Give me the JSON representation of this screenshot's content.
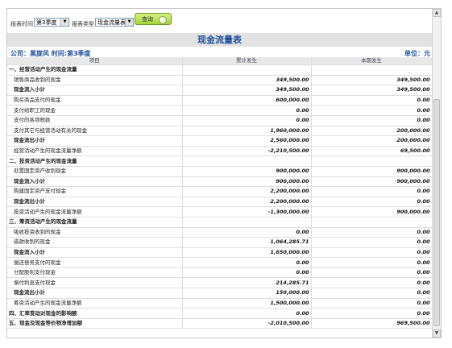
{
  "toolbar": {
    "period_label": "报表时间",
    "period_value": "第3季度",
    "type_label": "报表类型",
    "type_value": "现金流量表",
    "query_button": "查询"
  },
  "report": {
    "title": "现金流量表",
    "company_line": "公司：黑旋风  时间:第3季度",
    "unit_line": "单位：元",
    "columns": [
      "项目",
      "累计发生",
      "本期发生"
    ],
    "rows": [
      {
        "kind": "section",
        "label": "一、经营活动产生的现金流量",
        "cum": "",
        "cur": ""
      },
      {
        "kind": "sub",
        "label": "销售商品收到的现金",
        "cum": "349,500.00",
        "cur": "349,500.00"
      },
      {
        "kind": "subbold",
        "label": "现金流入小计",
        "cum": "349,500.00",
        "cur": "349,500.00"
      },
      {
        "kind": "sub",
        "label": "购买商品支付的现金",
        "cum": "600,000.00",
        "cur": "0.00"
      },
      {
        "kind": "sub",
        "label": "支付给职工的现金",
        "cum": "0.00",
        "cur": "0.00"
      },
      {
        "kind": "sub",
        "label": "支付的各项税款",
        "cum": "0.00",
        "cur": "0.00"
      },
      {
        "kind": "sub",
        "label": "支付其它与经营活动有关的现金",
        "cum": "1,960,000.00",
        "cur": "200,000.00"
      },
      {
        "kind": "subbold",
        "label": "现金流出小计",
        "cum": "2,560,000.00",
        "cur": "200,000.00"
      },
      {
        "kind": "sub",
        "label": "经营活动产生的现金流量净额",
        "cum": "-2,210,500.00",
        "cur": "69,500.00"
      },
      {
        "kind": "section",
        "label": "二、投资活动产生的现金流量",
        "cum": "",
        "cur": ""
      },
      {
        "kind": "sub",
        "label": "处置固定资产收到现金",
        "cum": "900,000.00",
        "cur": "900,000.00"
      },
      {
        "kind": "subbold",
        "label": "现金流入小计",
        "cum": "900,000.00",
        "cur": "900,000.00"
      },
      {
        "kind": "sub",
        "label": "购建固定资产支付现金",
        "cum": "2,200,000.00",
        "cur": "0.00"
      },
      {
        "kind": "subbold",
        "label": "现金流出小计",
        "cum": "2,200,000.00",
        "cur": "0.00"
      },
      {
        "kind": "sub",
        "label": "投资活动产生的现金流量净额",
        "cum": "-1,300,000.00",
        "cur": "900,000.00"
      },
      {
        "kind": "section",
        "label": "三、筹资活动产生的现金流量",
        "cum": "",
        "cur": ""
      },
      {
        "kind": "sub",
        "label": "吸收投资收到的现金",
        "cum": "0.00",
        "cur": "0.00"
      },
      {
        "kind": "sub",
        "label": "借款收到的现金",
        "cum": "1,064,285.71",
        "cur": "0.00"
      },
      {
        "kind": "subbold",
        "label": "现金流入小计",
        "cum": "1,650,000.00",
        "cur": "0.00"
      },
      {
        "kind": "sub",
        "label": "偿还债务支付的现金",
        "cum": "0.00",
        "cur": "0.00"
      },
      {
        "kind": "sub",
        "label": "分配股利支付现金",
        "cum": "0.00",
        "cur": "0.00"
      },
      {
        "kind": "sub",
        "label": "偿付利息支付现金",
        "cum": "214,285.71",
        "cur": "0.00"
      },
      {
        "kind": "subbold",
        "label": "现金流出小计",
        "cum": "150,000.00",
        "cur": "0.00"
      },
      {
        "kind": "sub",
        "label": "筹资活动产生的现金流量净额",
        "cum": "1,500,000.00",
        "cur": "0.00"
      },
      {
        "kind": "section",
        "label": "四、汇率变动对现金的影响额",
        "cum": "0.00",
        "cur": "0.00"
      },
      {
        "kind": "section",
        "label": "五、现金及现金等价物净增加额",
        "cum": "-2,010,500.00",
        "cur": "969,500.00"
      }
    ]
  }
}
